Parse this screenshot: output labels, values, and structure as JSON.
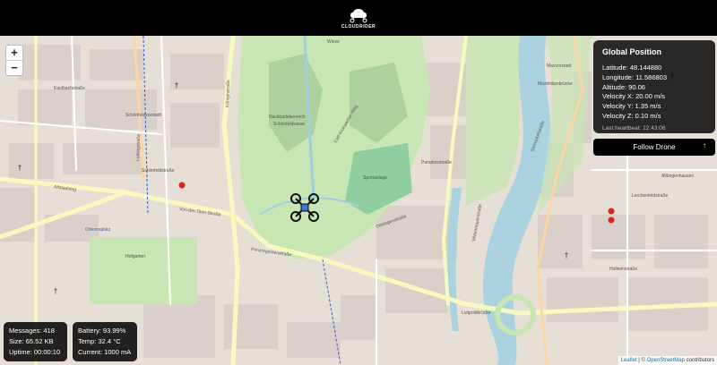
{
  "header": {
    "logo_text": "CLOUDRIDER"
  },
  "map": {
    "zoom_in": "+",
    "zoom_out": "−",
    "labels": [
      "Schönfeldvorstadt",
      "Wiese",
      "Nackbadeberreich",
      "Schönfeldwiese",
      "Carl-Kronawitter-Weg",
      "Altstadtring",
      "Von-der-Tann-Straße",
      "Prinzregentenstraße",
      "Hofgarten",
      "Odeonsplatz",
      "Maxvorstadt",
      "Paradiesstraße",
      "Sportanlage",
      "Oettingenstraße",
      "Lerchenfeldstraße",
      "Widenmayerstraße",
      "Luitpoldbrücke",
      "Maximilianbrücke",
      "Altbogenhausen",
      "Holbeinstraße",
      "Schönfeldstraße",
      "Ludwigstraße",
      "Kaulbachstraße",
      "Königinstraße",
      "Steinsdorfstraße"
    ]
  },
  "position_panel": {
    "title": "Global Position",
    "latitude": "Latitude: 48.144880",
    "longitude": "Longitude: 11.586803",
    "altitude": "Altitude: 90.06",
    "vx": "Velocity X: 20.00 m/s",
    "vy": "Velocity Y: 1.35 m/s",
    "vz": "Velocity Z: 0.10 m/s",
    "heartbeat": "Last heartbeat: 22:43:06"
  },
  "follow_button": {
    "label": "Follow Drone",
    "icon": "arrow-up-icon",
    "glyph": "↑"
  },
  "stats_left": {
    "messages": "Messages: 418",
    "size": "Size: 65.52 KB",
    "uptime": "Uptime: 00:00:10"
  },
  "stats_right": {
    "battery": "Battery: 93.99%",
    "temp": "Temp: 32.4 °C",
    "current": "Current: 1000 mA"
  },
  "attribution": {
    "leaflet": "Leaflet",
    "separator": " | © ",
    "osm": "OpenStreetMap",
    "contributors": " contributors"
  },
  "colors": {
    "park": "#c8e6b4",
    "park_dark": "#add19e",
    "water": "#aad3df",
    "road_major": "#f7fabf",
    "road_secondary": "#fcd6a4",
    "built": "#d9d0c9"
  }
}
